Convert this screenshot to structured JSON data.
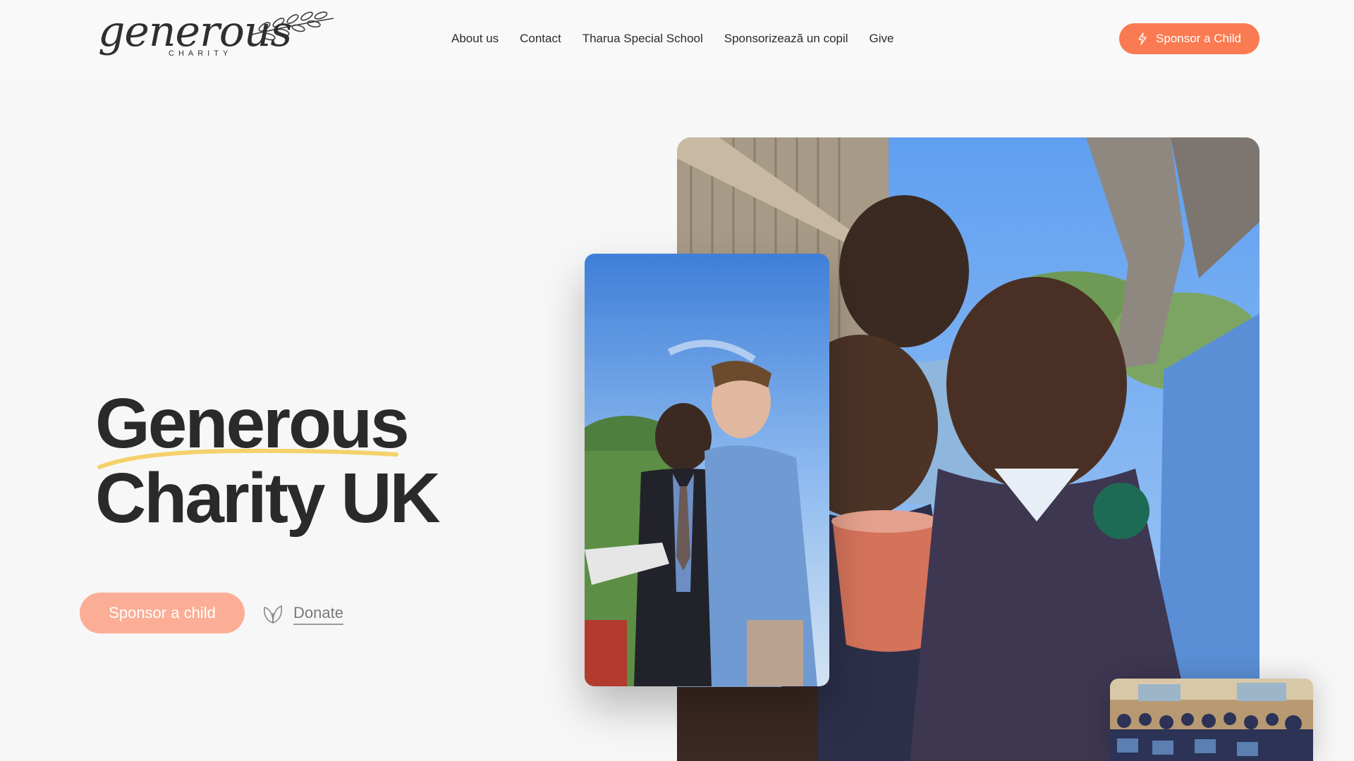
{
  "header": {
    "logo": {
      "wordmark": "generous",
      "subtitle": "CHARITY"
    },
    "nav": [
      {
        "label": "About us"
      },
      {
        "label": "Contact"
      },
      {
        "label": "Tharua Special School"
      },
      {
        "label": "Sponsorizează un copil"
      },
      {
        "label": "Give"
      }
    ],
    "cta_label": "Sponsor a Child",
    "cta_icon": "lightning-icon"
  },
  "hero": {
    "title_line1": "Generous",
    "title_line2": "Charity UK",
    "primary_cta": "Sponsor a child",
    "secondary_cta": "Donate",
    "secondary_icon": "leaf-icon"
  },
  "colors": {
    "accent": "#fa7a52",
    "accent_light": "#fbae95",
    "underline": "#f5d16a",
    "background": "#f7f7f7"
  }
}
